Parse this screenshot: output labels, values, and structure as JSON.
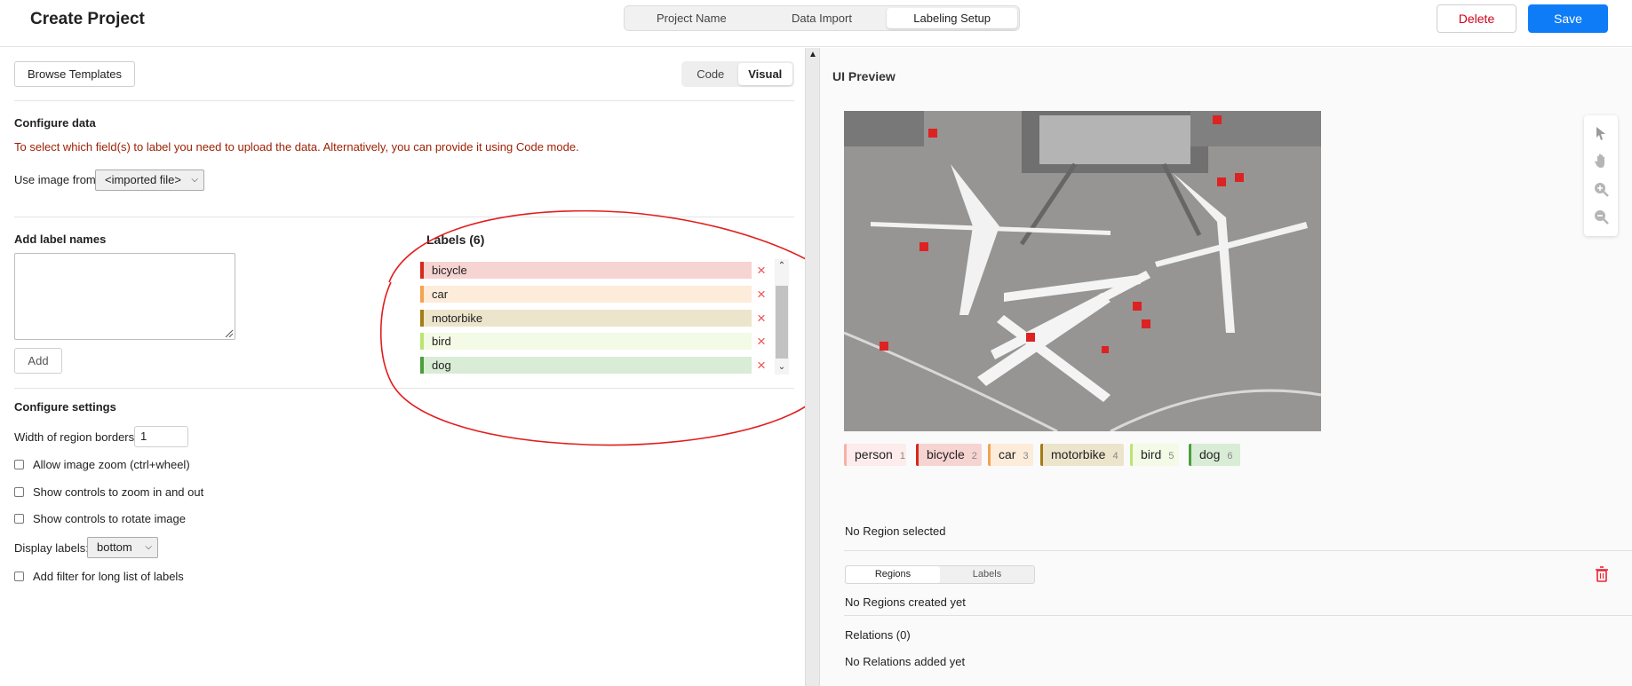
{
  "header": {
    "title": "Create Project",
    "steps": [
      "Project Name",
      "Data Import",
      "Labeling Setup"
    ],
    "delete_label": "Delete",
    "save_label": "Save"
  },
  "left": {
    "browse_label": "Browse Templates",
    "mode_code": "Code",
    "mode_visual": "Visual",
    "configure_data_title": "Configure data",
    "warning": "To select which field(s) to label you need to upload the data. Alternatively, you can provide it using Code mode.",
    "use_image_from_label": "Use image from",
    "use_image_from_value": "<imported file>",
    "add_label_names_title": "Add label names",
    "add_button": "Add",
    "labels_title": "Labels (6)",
    "labels": [
      {
        "name": "bicycle",
        "color": "#d52a1a",
        "bg": "#f6d4d1"
      },
      {
        "name": "car",
        "color": "#f4a24f",
        "bg": "#fdecda"
      },
      {
        "name": "motorbike",
        "color": "#a47b16",
        "bg": "#ede4cc"
      },
      {
        "name": "bird",
        "color": "#bbe470",
        "bg": "#f3fae5"
      },
      {
        "name": "dog",
        "color": "#4b9e3b",
        "bg": "#d9ecd6"
      }
    ],
    "configure_settings_title": "Configure settings",
    "width_label": "Width of region borders",
    "width_value": "1",
    "allow_zoom": "Allow image zoom (ctrl+wheel)",
    "show_zoom_controls": "Show controls to zoom in and out",
    "show_rotate_controls": "Show controls to rotate image",
    "display_labels_label": "Display labels:",
    "display_labels_value": "bottom",
    "add_filter": "Add filter for long list of labels"
  },
  "right": {
    "preview_title": "UI Preview",
    "chips": [
      {
        "name": "person",
        "hotkey": "1",
        "color": "#f7b0a8",
        "bg": "#fdeceb"
      },
      {
        "name": "bicycle",
        "hotkey": "2",
        "color": "#d52a1a",
        "bg": "#f6d4d1"
      },
      {
        "name": "car",
        "hotkey": "3",
        "color": "#f4a24f",
        "bg": "#fdecda"
      },
      {
        "name": "motorbike",
        "hotkey": "4",
        "color": "#a47b16",
        "bg": "#ede4cc"
      },
      {
        "name": "bird",
        "hotkey": "5",
        "color": "#bbe470",
        "bg": "#f3fae5"
      },
      {
        "name": "dog",
        "hotkey": "6",
        "color": "#4b9e3b",
        "bg": "#d9ecd6"
      }
    ],
    "no_region": "No Region selected",
    "tab_regions": "Regions",
    "tab_labels": "Labels",
    "no_regions": "No Regions created yet",
    "relations_title": "Relations (0)",
    "no_relations": "No Relations added yet"
  },
  "icons": [
    "pointer-icon",
    "hand-icon",
    "zoom-in-icon",
    "zoom-out-icon",
    "trash-icon",
    "chevron-down-icon",
    "x-icon",
    "resize-grip-icon"
  ],
  "colors": {
    "accent": "#0f7cf7",
    "danger": "#d0021b",
    "warning_text": "#9d1e00",
    "annotation_circle": "#e21d1d"
  }
}
